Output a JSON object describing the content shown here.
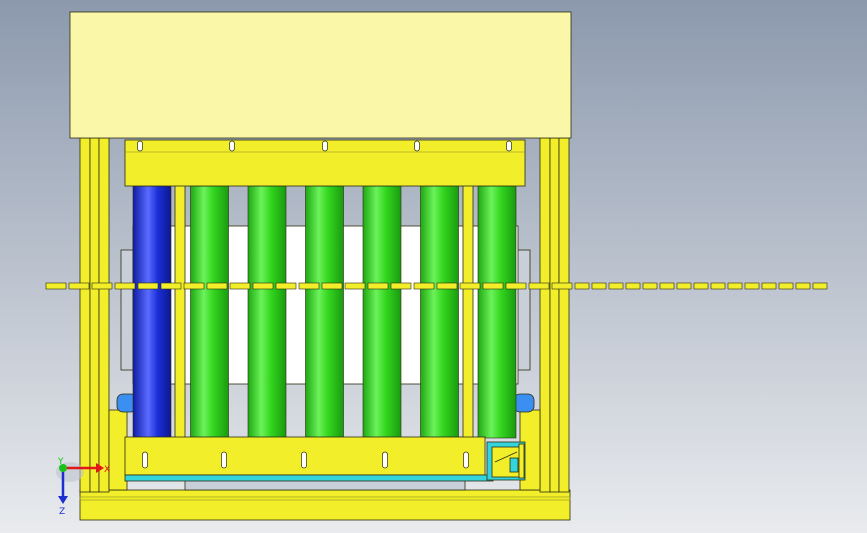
{
  "viewport": {
    "background_top": "#8c99ad",
    "background_bottom": "#e9ebee"
  },
  "colors": {
    "frame_yellow": "#f2ee2a",
    "top_housing": "#fbf7a8",
    "outline": "#2b2b10",
    "roller_green": "#33d61e",
    "roller_blue": "#1a2fd8",
    "window_white": "#ffffff",
    "cyan_plate": "#33d4dc",
    "gray_block": "#c9cfd8",
    "blue_motor": "#3a8ff0"
  },
  "rollers": {
    "count": 7,
    "first_roller_color": "blue",
    "other_rollers_color": "green"
  },
  "fasteners": {
    "top_slots": 5,
    "bottom_slots": 5
  },
  "triad": {
    "x_label": "X",
    "y_label": "Y",
    "z_label": "Z",
    "x_color": "#e01818",
    "y_color": "#19c21a",
    "z_color": "#1c2ed0"
  }
}
